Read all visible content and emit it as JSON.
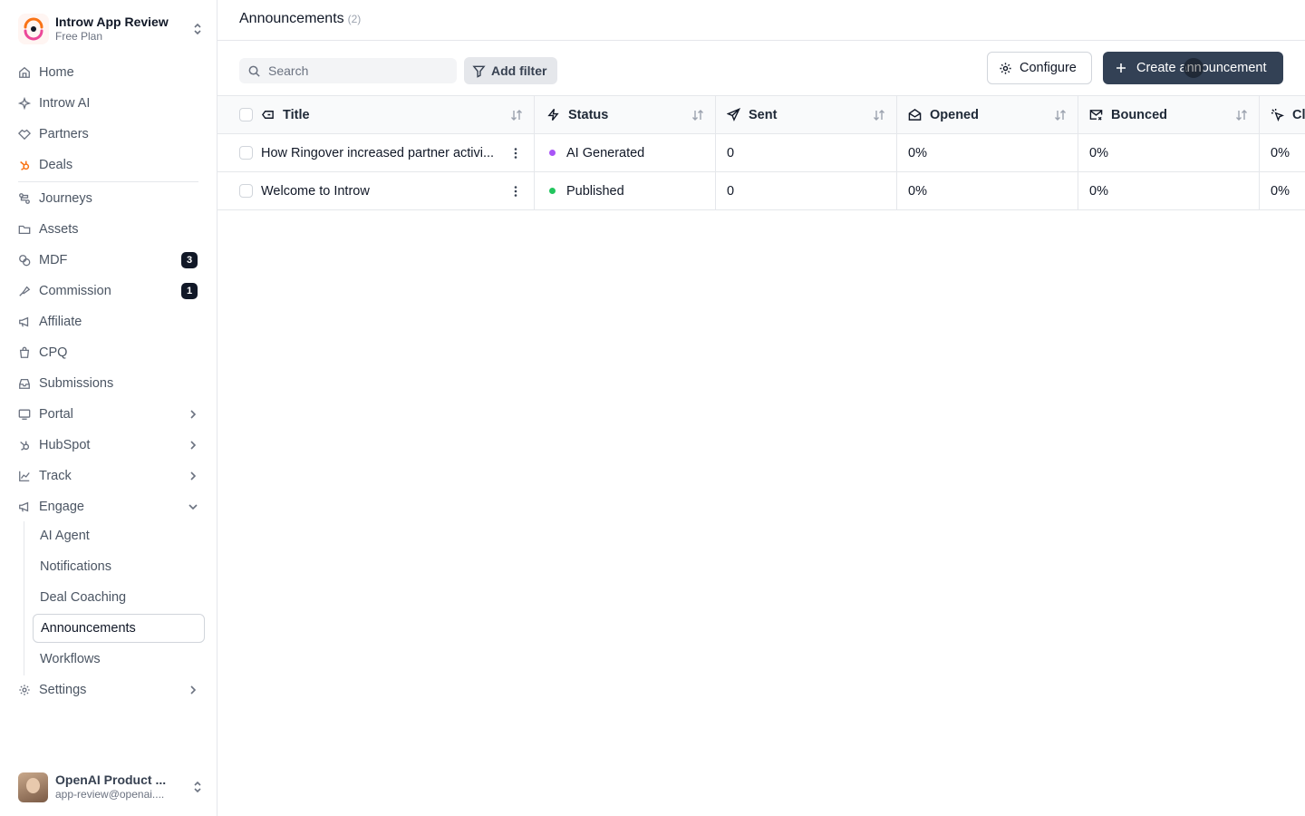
{
  "workspace": {
    "name": "Introw App Review",
    "plan": "Free Plan"
  },
  "nav": {
    "home": "Home",
    "introw_ai": "Introw AI",
    "partners": "Partners",
    "deals": "Deals",
    "journeys": "Journeys",
    "assets": "Assets",
    "mdf": "MDF",
    "mdf_badge": "3",
    "commission": "Commission",
    "commission_badge": "1",
    "affiliate": "Affiliate",
    "cpq": "CPQ",
    "submissions": "Submissions",
    "portal": "Portal",
    "hubspot": "HubSpot",
    "track": "Track",
    "engage": "Engage",
    "engage_sub": {
      "ai_agent": "AI Agent",
      "notifications": "Notifications",
      "deal_coaching": "Deal Coaching",
      "announcements": "Announcements",
      "workflows": "Workflows"
    },
    "settings": "Settings"
  },
  "user": {
    "name": "OpenAI Product ...",
    "email": "app-review@openai...."
  },
  "page": {
    "title": "Announcements",
    "count": "(2)"
  },
  "toolbar": {
    "search_placeholder": "Search",
    "add_filter": "Add filter",
    "configure": "Configure",
    "create": "Create announcement"
  },
  "table": {
    "columns": {
      "title": "Title",
      "status": "Status",
      "sent": "Sent",
      "opened": "Opened",
      "bounced": "Bounced",
      "clicked": "Cl"
    },
    "rows": [
      {
        "title": "How Ringover increased partner activi...",
        "status": "AI Generated",
        "status_color": "#a855f7",
        "sent": "0",
        "opened": "0%",
        "bounced": "0%",
        "clicked": "0%"
      },
      {
        "title": "Welcome to Introw",
        "status": "Published",
        "status_color": "#22c55e",
        "sent": "0",
        "opened": "0%",
        "bounced": "0%",
        "clicked": "0%"
      }
    ]
  }
}
